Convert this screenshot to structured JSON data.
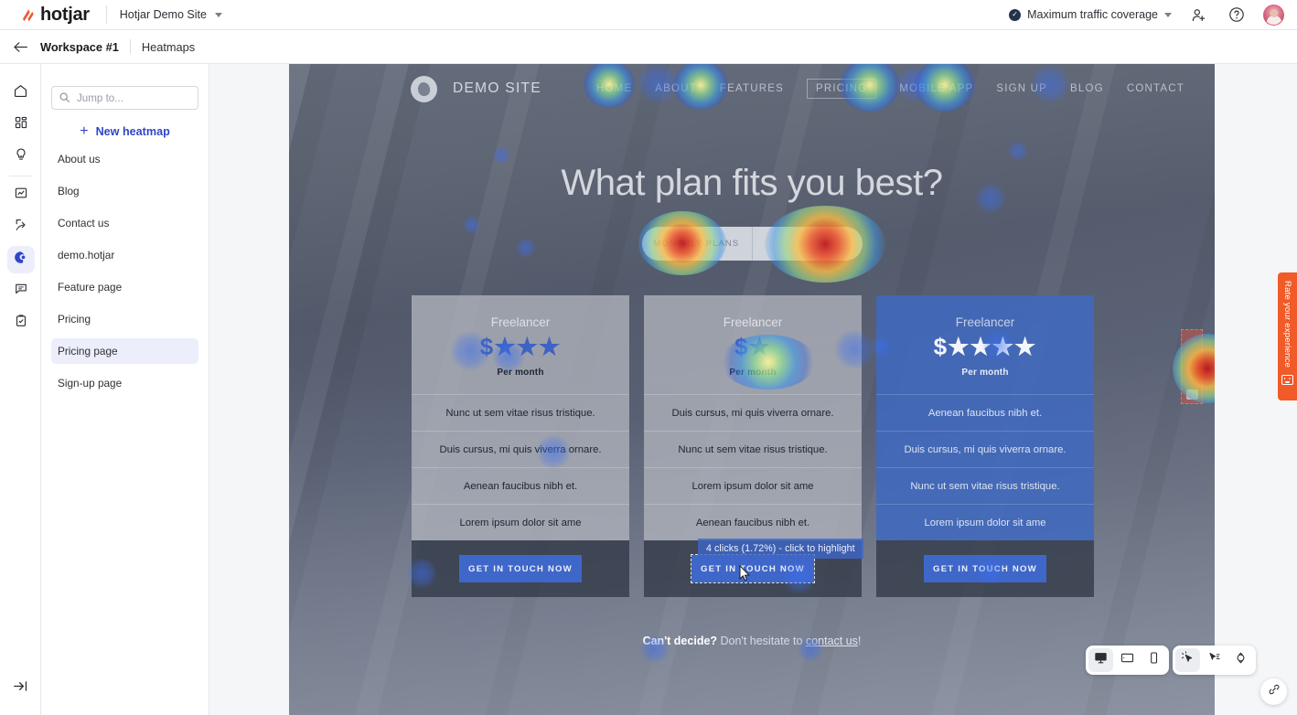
{
  "header": {
    "brand": "hotjar",
    "site_picker": "Hotjar Demo Site",
    "coverage_label": "Maximum traffic coverage",
    "check_glyph": "✓",
    "invite_icon": "add-user-icon",
    "help_icon": "help-icon",
    "avatar_icon": "user-avatar"
  },
  "subheader": {
    "back_icon": "back-arrow-icon",
    "workspace": "Workspace #1",
    "section": "Heatmaps"
  },
  "rail": [
    {
      "name": "home",
      "label": "Home",
      "glyph": "home-icon",
      "active": false
    },
    {
      "name": "dashboard",
      "label": "Dashboard",
      "glyph": "dashboard-icon",
      "active": false
    },
    {
      "name": "insights",
      "label": "Insights",
      "glyph": "lightbulb-icon",
      "active": false
    },
    {
      "name": "trends",
      "label": "Trends",
      "glyph": "chart-icon",
      "active": false
    },
    {
      "name": "recordings",
      "label": "Recordings",
      "glyph": "recordings-icon",
      "active": false
    },
    {
      "name": "heatmaps",
      "label": "Heatmaps",
      "glyph": "heatmap-icon",
      "active": true
    },
    {
      "name": "feedback",
      "label": "Feedback",
      "glyph": "speech-bubble-icon",
      "active": false
    },
    {
      "name": "surveys",
      "label": "Surveys",
      "glyph": "clipboard-icon",
      "active": false
    }
  ],
  "rail_bottom": {
    "name": "collapse",
    "label": "Expand sidebar",
    "glyph": "expand-panel-icon"
  },
  "sidebar": {
    "search_placeholder": "Jump to...",
    "search_value": "",
    "new_heatmap_label": "New heatmap",
    "new_heatmap_plus": "+",
    "items": [
      {
        "label": "About us",
        "selected": false
      },
      {
        "label": "Blog",
        "selected": false
      },
      {
        "label": "Contact us",
        "selected": false
      },
      {
        "label": "demo.hotjar",
        "selected": false
      },
      {
        "label": "Feature page",
        "selected": false
      },
      {
        "label": "Pricing",
        "selected": false
      },
      {
        "label": "Pricing page",
        "selected": true
      },
      {
        "label": "Sign-up page",
        "selected": false
      }
    ]
  },
  "screenshot": {
    "site_title": "DEMO SITE",
    "nav_links": [
      {
        "label": "HOME",
        "boxed": false
      },
      {
        "label": "ABOUT",
        "boxed": false
      },
      {
        "label": "FEATURES",
        "boxed": false
      },
      {
        "label": "PRICING",
        "boxed": true
      },
      {
        "label": "MOBILE APP",
        "boxed": false
      },
      {
        "label": "SIGN UP",
        "boxed": false
      },
      {
        "label": "BLOG",
        "boxed": false
      },
      {
        "label": "CONTACT",
        "boxed": false
      }
    ],
    "headline": "What plan fits you best?",
    "toggle": [
      {
        "label": "MONTHLY PLANS",
        "active": true
      },
      {
        "label": "",
        "active": false
      }
    ],
    "cards": [
      {
        "plan": "Freelancer",
        "price": "$★★★",
        "period": "Per month",
        "featured": false,
        "features": [
          "Nunc ut sem vitae risus tristique.",
          "Duis cursus, mi quis viverra ornare.",
          "Aenean faucibus nibh et.",
          "Lorem ipsum dolor sit ame"
        ],
        "cta": "GET IN TOUCH NOW",
        "cta_highlighted": false
      },
      {
        "plan": "Freelancer",
        "price": "$★",
        "period": "Per month",
        "featured": false,
        "features": [
          "Duis cursus, mi quis viverra ornare.",
          "Nunc ut sem vitae risus tristique.",
          "Lorem ipsum dolor sit ame",
          "Aenean faucibus nibh et."
        ],
        "cta": "GET IN TOUCH NOW",
        "cta_highlighted": true
      },
      {
        "plan": "Freelancer",
        "price": "$★★★★",
        "period": "Per month",
        "featured": true,
        "features": [
          "Aenean faucibus nibh et.",
          "Duis cursus, mi quis viverra ornare.",
          "Nunc ut sem vitae risus tristique.",
          "Lorem ipsum dolor sit ame"
        ],
        "cta": "GET IN TOUCH NOW",
        "cta_highlighted": false
      }
    ],
    "closing_bold": "Can't decide?",
    "closing_mid": " Don't hesitate to ",
    "closing_link": "contact us",
    "closing_end": "!"
  },
  "tooltip": {
    "text": "4 clicks (1.72%) - click to highlight"
  },
  "device_toolbar": [
    {
      "name": "desktop",
      "glyph": "desktop-icon",
      "active": true
    },
    {
      "name": "tablet",
      "glyph": "tablet-icon",
      "active": false
    },
    {
      "name": "mobile",
      "glyph": "mobile-icon",
      "active": false
    }
  ],
  "map_toolbar": [
    {
      "name": "click-map",
      "glyph": "click-heatmap-icon",
      "active": true
    },
    {
      "name": "move-map",
      "glyph": "move-heatmap-icon",
      "active": false
    },
    {
      "name": "scroll-map",
      "glyph": "scroll-heatmap-icon",
      "active": false
    }
  ],
  "share_fab": {
    "name": "copy-link",
    "glyph": "link-icon"
  },
  "rate_widget": {
    "label": "Rate your experience",
    "color": "#f05b29"
  },
  "theme": {
    "accent": "#2f46c8",
    "accent_soft": "#eceefb",
    "canvas_bg": "#f5f6f8",
    "cta_blue": "#3f67c9",
    "tooltip_blue": "rgba(63,103,201,0.80)"
  }
}
